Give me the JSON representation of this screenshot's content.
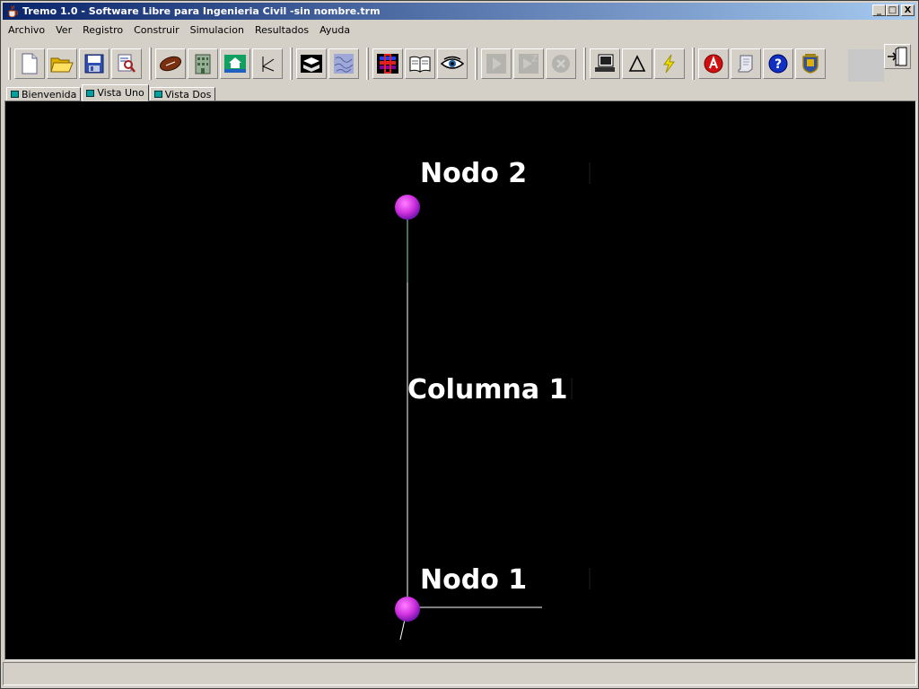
{
  "window": {
    "title": "Tremo 1.0 - Software Libre para Ingenieria Civil -sin nombre.trm",
    "minimize": "_",
    "maximize": "□",
    "close": "X"
  },
  "menu": [
    "Archivo",
    "Ver",
    "Registro",
    "Construir",
    "Simulacion",
    "Resultados",
    "Ayuda"
  ],
  "toolbar": {
    "icons": [
      "new-file-icon",
      "open-folder-icon",
      "save-icon",
      "search-document-icon",
      "football-icon",
      "building-icon",
      "home-icon",
      "axes-icon",
      "section-icon",
      "texture-icon",
      "color-bars-icon",
      "open-book-icon",
      "eye-icon",
      "play-icon",
      "step-icon",
      "stop-icon",
      "computer-icon",
      "delta-icon",
      "lightning-icon",
      "adobe-reader-icon",
      "scroll-icon",
      "help-icon",
      "emblem-icon"
    ],
    "exit_icon": "exit-door-icon"
  },
  "tabs": [
    {
      "label": "Bienvenida",
      "active": false
    },
    {
      "label": "Vista Uno",
      "active": true
    },
    {
      "label": "Vista Dos",
      "active": false
    }
  ],
  "scene": {
    "node_top_label": "Nodo 2",
    "node_bottom_label": "Nodo 1",
    "column_label": "Columna 1",
    "node_color": "#d040e0",
    "column_color": "#ffffff",
    "background": "#000000"
  },
  "colors": {
    "titlebar_start": "#0a246a",
    "titlebar_end": "#a6caf0",
    "chrome": "#d4d0c8"
  }
}
